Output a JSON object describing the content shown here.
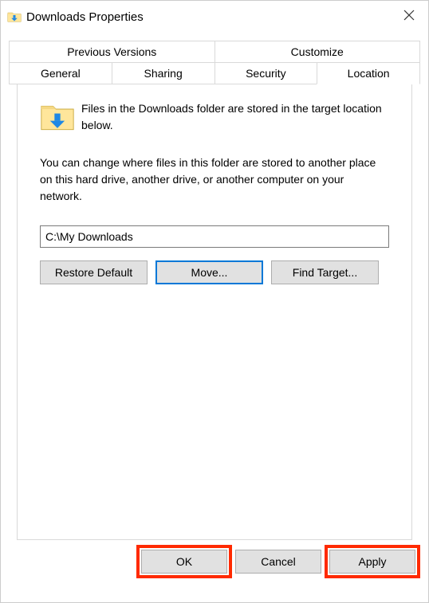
{
  "titlebar": {
    "title": "Downloads Properties"
  },
  "tabs": {
    "row1": [
      {
        "label": "Previous Versions"
      },
      {
        "label": "Customize"
      }
    ],
    "row2": [
      {
        "label": "General"
      },
      {
        "label": "Sharing"
      },
      {
        "label": "Security"
      },
      {
        "label": "Location"
      }
    ],
    "active": "Location"
  },
  "content": {
    "info": "Files in the Downloads folder are stored in the target location below.",
    "description": "You can change where files in this folder are stored to another place on this hard drive, another drive, or another computer on your network.",
    "path": "C:\\My Downloads",
    "buttons": {
      "restore": "Restore Default",
      "move": "Move...",
      "find": "Find Target..."
    }
  },
  "bottom": {
    "ok": "OK",
    "cancel": "Cancel",
    "apply": "Apply"
  }
}
